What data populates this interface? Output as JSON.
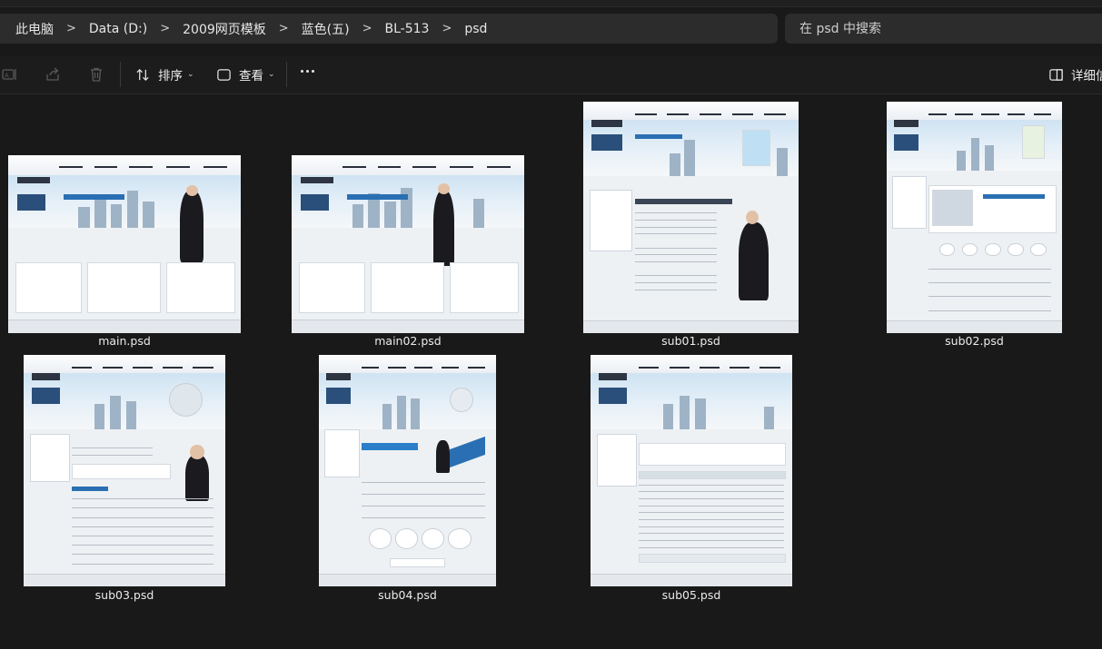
{
  "breadcrumb": [
    {
      "label": "此电脑"
    },
    {
      "label": "Data (D:)"
    },
    {
      "label": "2009网页模板"
    },
    {
      "label": "蓝色(五)"
    },
    {
      "label": "BL-513"
    },
    {
      "label": "psd"
    }
  ],
  "breadcrumb_separator": ">",
  "search": {
    "placeholder": "在 psd 中搜索"
  },
  "toolbar": {
    "sort_label": "排序",
    "view_label": "查看",
    "details_label": "详细信"
  },
  "icons": {
    "rename": "rename-icon",
    "share": "share-icon",
    "delete": "trash-icon",
    "sort": "sort-icon",
    "view": "view-icon",
    "more": "more-icon",
    "details": "details-pane-icon"
  },
  "files": [
    {
      "name": "main.psd"
    },
    {
      "name": "main02.psd"
    },
    {
      "name": "sub01.psd"
    },
    {
      "name": "sub02.psd"
    },
    {
      "name": "sub03.psd"
    },
    {
      "name": "sub04.psd"
    },
    {
      "name": "sub05.psd"
    }
  ],
  "colors": {
    "background": "#191919",
    "bar": "#2c2c2c",
    "text": "#e8e8e8",
    "accent": "#2a6fb3"
  }
}
